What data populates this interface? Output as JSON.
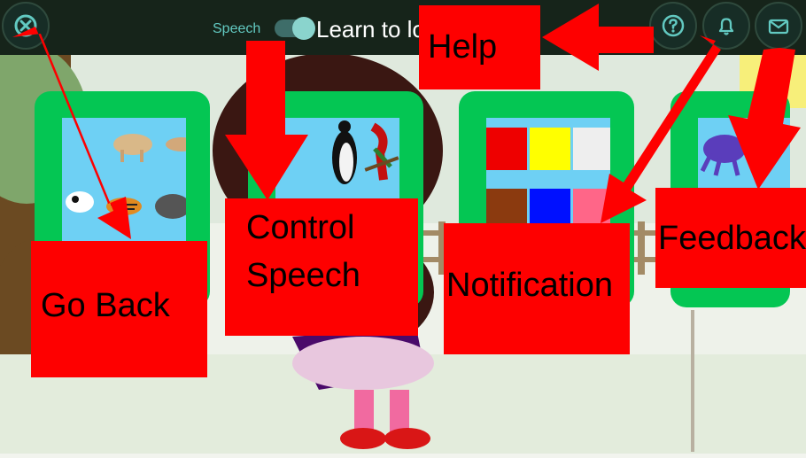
{
  "topbar": {
    "speech_label": "Speech",
    "title_visible": "Learn to lo",
    "buttons": [
      {
        "name": "close-icon",
        "interactable": true
      },
      {
        "name": "help-icon",
        "interactable": true
      },
      {
        "name": "bell-icon",
        "interactable": true
      },
      {
        "name": "mail-icon",
        "interactable": true
      }
    ],
    "colors": {
      "bar": "#16241a",
      "accent": "#62c9c1"
    }
  },
  "cards": [
    {
      "name": "animals-card",
      "icon": "animals-icon"
    },
    {
      "name": "birds-card",
      "icon": "birds-icon"
    },
    {
      "name": "colors-card",
      "icon": "colors-icon"
    },
    {
      "name": "sea-life-card",
      "icon": "sea-life-icon"
    }
  ],
  "annotations": {
    "go_back": "Go Back",
    "control_speech_line1": "Control",
    "control_speech_line2": "Speech",
    "help": "Help",
    "notification": "Notification",
    "feedback": "Feedback"
  },
  "colors": {
    "card_border": "#04c653",
    "callout": "#fe0000",
    "swatches": [
      "#ee0000",
      "#ffff00",
      "#eeeeee",
      "#8b3a0f",
      "#0010ff",
      "#ff6688"
    ]
  }
}
